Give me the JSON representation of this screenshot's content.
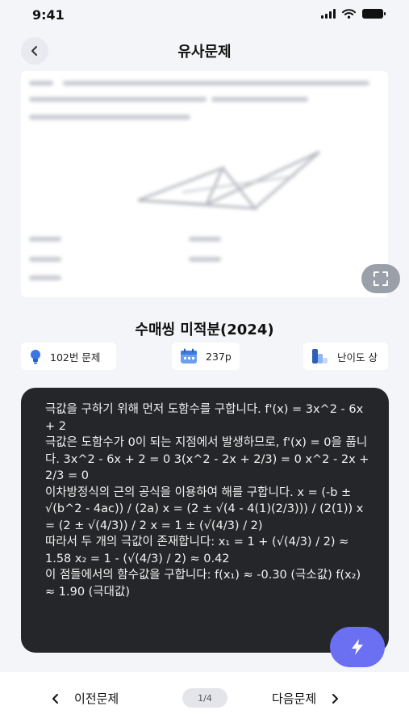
{
  "status": {
    "time": "9:41"
  },
  "header": {
    "title": "유사문제",
    "back_icon": "chevron-left-icon"
  },
  "problem": {
    "expand_icon": "fullscreen-icon"
  },
  "book": {
    "title": "수매씽 미적분(2024)",
    "chips": [
      {
        "icon": "lightbulb-icon",
        "label": "102번 문제"
      },
      {
        "icon": "calendar-icon",
        "label": "237p"
      },
      {
        "icon": "difficulty-bars-icon",
        "label": "난이도 상"
      }
    ]
  },
  "solution": {
    "paragraphs": [
      "극값을 구하기 위해 먼저 도함수를 구합니다. f'(x) = 3x^2 - 6x + 2",
      "극값은 도함수가 0이 되는 지점에서 발생하므로, f'(x) = 0을 풉니다. 3x^2 - 6x + 2 = 0 3(x^2 - 2x + 2/3) = 0 x^2 - 2x + 2/3 = 0",
      "이차방정식의 근의 공식을 이용하여 해를 구합니다. x = (-b ± √(b^2 - 4ac)) / (2a) x = (2 ± √(4 - 4(1)(2/3))) / (2(1)) x = (2 ± √(4/3)) / 2 x = 1 ± (√(4/3) / 2)",
      "따라서 두 개의 극값이 존재합니다: x₁ = 1 + (√(4/3) / 2) ≈ 1.58 x₂ = 1 - (√(4/3) / 2) ≈ 0.42",
      "이 점들에서의 함수값을 구합니다: f(x₁) ≈ -0.30 (극소값) f(x₂) ≈ 1.90 (극대값)"
    ],
    "fab_icon": "lightning-icon"
  },
  "nav": {
    "prev_label": "이전문제",
    "next_label": "다음문제",
    "page_indicator": "1/4"
  },
  "colors": {
    "accent": "#6b6ff2",
    "dark_panel": "#252629",
    "background": "#f4f5f8"
  }
}
